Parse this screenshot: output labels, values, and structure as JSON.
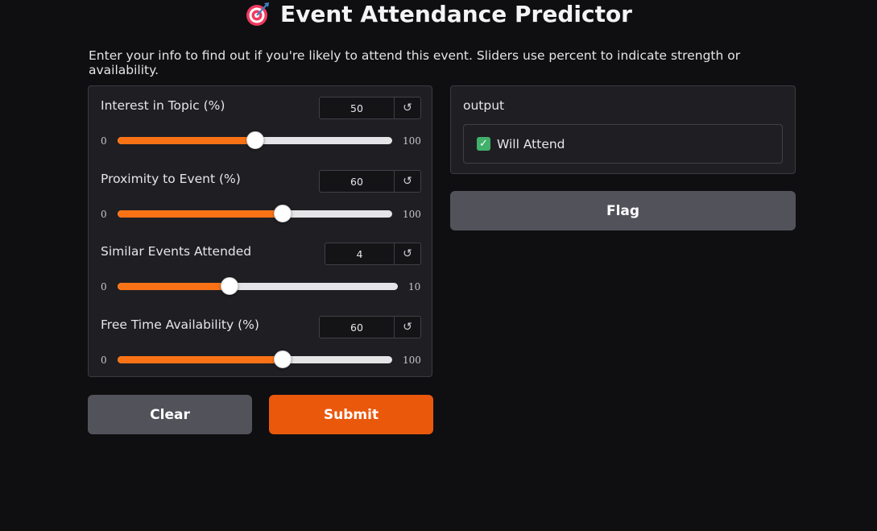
{
  "header": {
    "title": "Event Attendance Predictor",
    "icon": "target-icon",
    "description": "Enter your info to find out if you're likely to attend this event. Sliders use percent to indicate strength or availability."
  },
  "inputs": [
    {
      "label": "Interest in Topic (%)",
      "value": "50",
      "min": "0",
      "max": "100",
      "fraction": 0.5
    },
    {
      "label": "Proximity to Event (%)",
      "value": "60",
      "min": "0",
      "max": "100",
      "fraction": 0.6
    },
    {
      "label": "Similar Events Attended",
      "value": "4",
      "min": "0",
      "max": "10",
      "fraction": 0.4
    },
    {
      "label": "Free Time Availability (%)",
      "value": "60",
      "min": "0",
      "max": "100",
      "fraction": 0.6
    }
  ],
  "reset_glyph": "↺",
  "buttons": {
    "clear": "Clear",
    "submit": "Submit",
    "flag": "Flag"
  },
  "output": {
    "label": "output",
    "result": "Will Attend",
    "check_glyph": "✓"
  },
  "colors": {
    "accent": "#f97316",
    "submit": "#ea580c",
    "secondary_button": "#52525b",
    "check": "#41b06b"
  }
}
